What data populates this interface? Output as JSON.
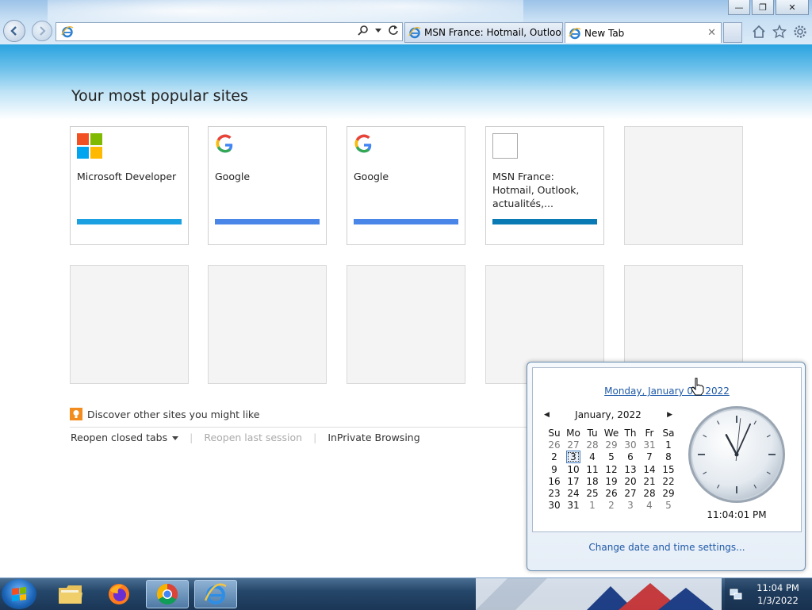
{
  "browser": {
    "address_value": "",
    "tabs": [
      {
        "label": "MSN France: Hotmail, Outlook..."
      },
      {
        "label": "New Tab",
        "close": "✕"
      }
    ],
    "window_controls": {
      "minimize": "—",
      "restore": "❐",
      "close": "✕"
    }
  },
  "page": {
    "heading": "Your most popular sites",
    "tiles_row1": [
      {
        "title": "Microsoft Developer",
        "icon": "microsoft-logo-icon",
        "bar_color": "#1ba1e2"
      },
      {
        "title": "Google",
        "icon": "google-logo-icon",
        "bar_color": "#4a86e8"
      },
      {
        "title": "Google",
        "icon": "google-logo-icon",
        "bar_color": "#4a86e8"
      },
      {
        "title": "MSN France: Hotmail, Outlook, actualités,...",
        "icon": "blank-site-icon",
        "bar_color": "#0a7ab5"
      },
      {
        "title": "",
        "icon": "",
        "bar_color": ""
      }
    ],
    "discover_text": "Discover other sites you might like",
    "links": {
      "reopen_closed_tabs": "Reopen closed tabs",
      "reopen_last_session": "Reopen last session",
      "inprivate": "InPrivate Browsing"
    }
  },
  "calendar": {
    "date_link": "Monday, January 03, 2022",
    "month_label": "January, 2022",
    "weekdays": [
      "Su",
      "Mo",
      "Tu",
      "We",
      "Th",
      "Fr",
      "Sa"
    ],
    "weeks": [
      [
        "26",
        "27",
        "28",
        "29",
        "30",
        "31",
        "1"
      ],
      [
        "2",
        "3",
        "4",
        "5",
        "6",
        "7",
        "8"
      ],
      [
        "9",
        "10",
        "11",
        "12",
        "13",
        "14",
        "15"
      ],
      [
        "16",
        "17",
        "18",
        "19",
        "20",
        "21",
        "22"
      ],
      [
        "23",
        "24",
        "25",
        "26",
        "27",
        "28",
        "29"
      ],
      [
        "30",
        "31",
        "1",
        "2",
        "3",
        "4",
        "5"
      ]
    ],
    "selected_day": "3",
    "clock_time": "11:04:01 PM",
    "clock_hours": 11,
    "clock_minutes": 4,
    "clock_seconds": 1,
    "change_settings": "Change date and time settings..."
  },
  "taskbar": {
    "apps": [
      "file-explorer-icon",
      "firefox-icon",
      "chrome-icon",
      "internet-explorer-icon"
    ],
    "tray_time": "11:04 PM",
    "tray_date": "1/3/2022"
  }
}
